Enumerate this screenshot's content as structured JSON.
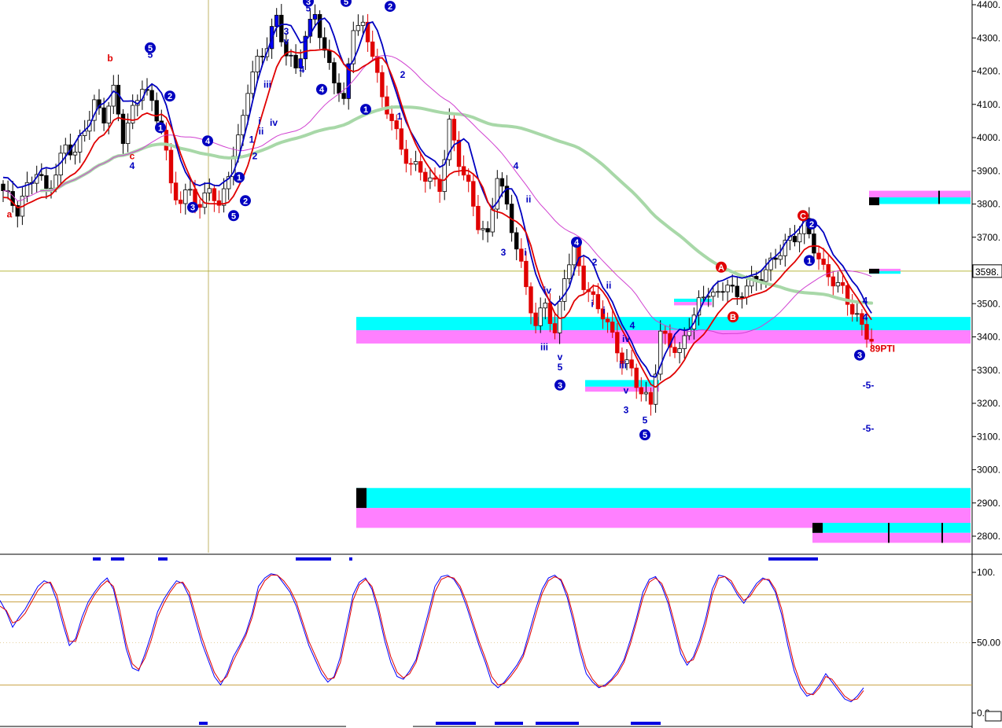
{
  "chart_data": [
    {
      "type": "candlestick",
      "y_ticks": [
        "4400.",
        "4300.",
        "4200.",
        "4100.",
        "4000.",
        "3900.",
        "3800.",
        "3700.",
        "3600.",
        "3500.",
        "3400.",
        "3300.",
        "3200.",
        "3100.",
        "3000.",
        "2900.",
        "2800."
      ],
      "ylim": [
        2750,
        4420
      ],
      "last_value_label": "3598.",
      "last_value": 3598,
      "price_path": [
        [
          0,
          3860
        ],
        [
          2,
          3820
        ],
        [
          4,
          3780
        ],
        [
          6,
          3850
        ],
        [
          8,
          3900
        ],
        [
          10,
          3840
        ],
        [
          12,
          3890
        ],
        [
          14,
          3980
        ],
        [
          16,
          3950
        ],
        [
          18,
          4030
        ],
        [
          20,
          4100
        ],
        [
          22,
          4060
        ],
        [
          24,
          4140
        ],
        [
          26,
          4000
        ],
        [
          28,
          4080
        ],
        [
          30,
          4160
        ],
        [
          32,
          4100
        ],
        [
          34,
          4030
        ],
        [
          36,
          3860
        ],
        [
          38,
          3800
        ],
        [
          40,
          3850
        ],
        [
          42,
          3780
        ],
        [
          44,
          3860
        ],
        [
          46,
          3780
        ],
        [
          48,
          3900
        ],
        [
          50,
          3990
        ],
        [
          52,
          4150
        ],
        [
          54,
          4230
        ],
        [
          56,
          4280
        ],
        [
          58,
          4360
        ],
        [
          60,
          4250
        ],
        [
          62,
          4210
        ],
        [
          64,
          4300
        ],
        [
          66,
          4380
        ],
        [
          68,
          4250
        ],
        [
          70,
          4180
        ],
        [
          72,
          4100
        ],
        [
          74,
          4340
        ],
        [
          76,
          4330
        ],
        [
          78,
          4260
        ],
        [
          80,
          4110
        ],
        [
          82,
          4060
        ],
        [
          84,
          3960
        ],
        [
          86,
          3920
        ],
        [
          88,
          3900
        ],
        [
          90,
          3870
        ],
        [
          92,
          3850
        ],
        [
          94,
          4040
        ],
        [
          96,
          3930
        ],
        [
          98,
          3850
        ],
        [
          100,
          3740
        ],
        [
          102,
          3700
        ],
        [
          104,
          3890
        ],
        [
          106,
          3790
        ],
        [
          108,
          3670
        ],
        [
          110,
          3550
        ],
        [
          112,
          3430
        ],
        [
          114,
          3510
        ],
        [
          116,
          3400
        ],
        [
          118,
          3590
        ],
        [
          120,
          3660
        ],
        [
          122,
          3560
        ],
        [
          124,
          3510
        ],
        [
          126,
          3470
        ],
        [
          128,
          3400
        ],
        [
          130,
          3330
        ],
        [
          132,
          3300
        ],
        [
          134,
          3230
        ],
        [
          136,
          3200
        ],
        [
          138,
          3410
        ],
        [
          140,
          3380
        ],
        [
          142,
          3350
        ],
        [
          144,
          3440
        ],
        [
          146,
          3500
        ],
        [
          148,
          3540
        ],
        [
          150,
          3520
        ],
        [
          152,
          3570
        ],
        [
          154,
          3510
        ],
        [
          156,
          3560
        ],
        [
          158,
          3570
        ],
        [
          160,
          3600
        ],
        [
          162,
          3640
        ],
        [
          164,
          3680
        ],
        [
          166,
          3700
        ],
        [
          168,
          3740
        ],
        [
          170,
          3670
        ],
        [
          172,
          3600
        ],
        [
          174,
          3570
        ],
        [
          176,
          3540
        ],
        [
          178,
          3480
        ],
        [
          180,
          3430
        ],
        [
          182,
          3390
        ]
      ],
      "hbars": [
        {
          "x0": 453,
          "x1": 1234,
          "top_color": "#00ffff",
          "bottom_color": "#ff80ff",
          "y_top": 3460,
          "y_mid": 3420,
          "y_bot": 3380
        },
        {
          "x0": 744,
          "x1": 838,
          "top_color": "#00ffff",
          "bottom_color": "#ff80ff",
          "y_top": 3270,
          "y_mid": 3250,
          "y_bot": 3235
        },
        {
          "x0": 857,
          "x1": 905,
          "top_color": "#00ffff",
          "bottom_color": "#ff80ff",
          "y_top": 3515,
          "y_mid": 3505,
          "y_bot": 3495
        },
        {
          "x0": 453,
          "x1": 1234,
          "top_color": "#00ffff",
          "bottom_color": "#ff80ff",
          "y_top": 2945,
          "y_mid": 2885,
          "y_bot": 2825
        },
        {
          "x0": 1105,
          "x1": 1234,
          "top_color": "#ff80ff",
          "bottom_color": "#00ffff",
          "y_top": 3840,
          "y_mid": 3820,
          "y_bot": 3800
        },
        {
          "x0": 1105,
          "x1": 1145,
          "top_color": "#ff80ff",
          "bottom_color": "#00ffff",
          "y_top": 3605,
          "y_mid": 3598,
          "y_bot": 3590
        },
        {
          "x0": 1033,
          "x1": 1234,
          "top_color": "#00ffff",
          "bottom_color": "#ff80ff",
          "y_top": 2840,
          "y_mid": 2810,
          "y_bot": 2780
        }
      ],
      "wave_labels": [
        {
          "t": "a",
          "c": "#e00000",
          "x": 12,
          "y": 3760
        },
        {
          "t": "b",
          "c": "#e00000",
          "x": 140,
          "y": 4230
        },
        {
          "t": "c",
          "c": "#e00000",
          "x": 168,
          "y": 3935
        },
        {
          "t": "4",
          "c": "#0000c0",
          "x": 168,
          "y": 3905
        },
        {
          "t": "5",
          "c": "#0000c0",
          "x": 191,
          "y": 4240
        },
        {
          "t": "1",
          "c": "#0000c0",
          "x": 320,
          "y": 3985
        },
        {
          "t": "i",
          "c": "#0000c0",
          "x": 330,
          "y": 4040
        },
        {
          "t": "ii",
          "c": "#0000c0",
          "x": 332,
          "y": 4010
        },
        {
          "t": "2",
          "c": "#0000c0",
          "x": 324,
          "y": 3935
        },
        {
          "t": "iii",
          "c": "#0000c0",
          "x": 340,
          "y": 4150
        },
        {
          "t": "iv",
          "c": "#0000c0",
          "x": 348,
          "y": 4035
        },
        {
          "t": "3",
          "c": "#0000c0",
          "x": 364,
          "y": 4310
        },
        {
          "t": "v",
          "c": "#0000c0",
          "x": 364,
          "y": 4280
        },
        {
          "t": "4",
          "c": "#0000c0",
          "x": 384,
          "y": 4195
        },
        {
          "t": "5",
          "c": "#0000c0",
          "x": 392,
          "y": 4380
        },
        {
          "t": "2",
          "c": "#0000c0",
          "x": 512,
          "y": 4180
        },
        {
          "t": "1",
          "c": "#0000c0",
          "x": 508,
          "y": 4055
        },
        {
          "t": "4",
          "c": "#0000c0",
          "x": 656,
          "y": 3905
        },
        {
          "t": "ii",
          "c": "#0000c0",
          "x": 672,
          "y": 3805
        },
        {
          "t": "3",
          "c": "#0000c0",
          "x": 640,
          "y": 3645
        },
        {
          "t": "i",
          "c": "#0000c0",
          "x": 668,
          "y": 3645
        },
        {
          "t": "iv",
          "c": "#0000c0",
          "x": 696,
          "y": 3530
        },
        {
          "t": "iii",
          "c": "#0000c0",
          "x": 692,
          "y": 3360
        },
        {
          "t": "v",
          "c": "#0000c0",
          "x": 712,
          "y": 3330
        },
        {
          "t": "5",
          "c": "#0000c0",
          "x": 712,
          "y": 3300
        },
        {
          "t": "2",
          "c": "#0000c0",
          "x": 756,
          "y": 3615
        },
        {
          "t": "ii",
          "c": "#0000c0",
          "x": 774,
          "y": 3545
        },
        {
          "t": "i",
          "c": "#0000c0",
          "x": 753,
          "y": 3490
        },
        {
          "t": "i",
          "c": "#0000c0",
          "x": 768,
          "y": 3470
        },
        {
          "t": "4",
          "c": "#0000c0",
          "x": 804,
          "y": 3425
        },
        {
          "t": "iv",
          "c": "#0000c0",
          "x": 796,
          "y": 3385
        },
        {
          "t": "iii",
          "c": "#0000c0",
          "x": 792,
          "y": 3305
        },
        {
          "t": "v",
          "c": "#0000c0",
          "x": 796,
          "y": 3230
        },
        {
          "t": "3",
          "c": "#0000c0",
          "x": 796,
          "y": 3170
        },
        {
          "t": "5",
          "c": "#0000c0",
          "x": 820,
          "y": 3140
        },
        {
          "t": "4",
          "c": "#0000c0",
          "x": 1100,
          "y": 3500
        },
        {
          "t": "4",
          "c": "#0000c0",
          "x": 1100,
          "y": 3450
        },
        {
          "t": "-5-",
          "c": "#0000c0",
          "x": 1104,
          "y": 3245
        },
        {
          "t": "-5-",
          "c": "#0000c0",
          "x": 1104,
          "y": 3115
        },
        {
          "t": "89PTI",
          "c": "#e00000",
          "x": 1122,
          "y": 3355
        }
      ],
      "wave_circles": [
        {
          "t": "5",
          "c": "#0000c0",
          "x": 191,
          "y": 4270
        },
        {
          "t": "2",
          "c": "#0000c0",
          "x": 216,
          "y": 4125
        },
        {
          "t": "1",
          "c": "#0000c0",
          "x": 204,
          "y": 4030
        },
        {
          "t": "3",
          "c": "#0000c0",
          "x": 245,
          "y": 3790
        },
        {
          "t": "4",
          "c": "#0000c0",
          "x": 264,
          "y": 3990
        },
        {
          "t": "5",
          "c": "#0000c0",
          "x": 297,
          "y": 3765
        },
        {
          "t": "1",
          "c": "#0000c0",
          "x": 304,
          "y": 3880
        },
        {
          "t": "2",
          "c": "#0000c0",
          "x": 312,
          "y": 3810
        },
        {
          "t": "4",
          "c": "#0000c0",
          "x": 409,
          "y": 4145
        },
        {
          "t": "3",
          "c": "#0000c0",
          "x": 392,
          "y": 4410
        },
        {
          "t": "5",
          "c": "#0000c0",
          "x": 440,
          "y": 4410
        },
        {
          "t": "1",
          "c": "#0000c0",
          "x": 465,
          "y": 4085
        },
        {
          "t": "2",
          "c": "#0000c0",
          "x": 496,
          "y": 4395
        },
        {
          "t": "4",
          "c": "#0000c0",
          "x": 733,
          "y": 3685
        },
        {
          "t": "3",
          "c": "#0000c0",
          "x": 712,
          "y": 3255
        },
        {
          "t": "5",
          "c": "#0000c0",
          "x": 820,
          "y": 3105
        },
        {
          "t": "A",
          "c": "#e00000",
          "x": 917,
          "y": 3610
        },
        {
          "t": "B",
          "c": "#e00000",
          "x": 932,
          "y": 3460
        },
        {
          "t": "C",
          "c": "#e00000",
          "x": 1021,
          "y": 3765
        },
        {
          "t": "2",
          "c": "#0000c0",
          "x": 1032,
          "y": 3740
        },
        {
          "t": "1",
          "c": "#0000c0",
          "x": 1029,
          "y": 3630
        },
        {
          "t": "3",
          "c": "#0000c0",
          "x": 1093,
          "y": 3345
        }
      ]
    },
    {
      "type": "line",
      "y_ticks": [
        "100.",
        "50.00",
        "0.0"
      ],
      "ylim": [
        0,
        100
      ],
      "ref_lines": [
        84,
        79,
        20
      ],
      "series": [
        {
          "color": "#0000ff",
          "values": [
            80,
            72,
            61,
            68,
            74,
            82,
            90,
            94,
            92,
            80,
            63,
            48,
            53,
            68,
            79,
            86,
            92,
            96,
            88,
            68,
            46,
            32,
            30,
            42,
            56,
            72,
            81,
            88,
            94,
            92,
            83,
            66,
            50,
            38,
            26,
            20,
            28,
            40,
            48,
            57,
            71,
            90,
            96,
            99,
            98,
            92,
            86,
            76,
            62,
            48,
            38,
            28,
            22,
            26,
            40,
            62,
            84,
            93,
            96,
            88,
            72,
            52,
            36,
            26,
            24,
            30,
            38,
            55,
            72,
            90,
            97,
            98,
            95,
            88,
            76,
            62,
            48,
            36,
            22,
            18,
            22,
            28,
            34,
            42,
            58,
            74,
            88,
            96,
            98,
            94,
            82,
            64,
            44,
            28,
            22,
            18,
            20,
            24,
            30,
            38,
            52,
            68,
            86,
            95,
            97,
            90,
            78,
            60,
            42,
            34,
            40,
            52,
            68,
            88,
            98,
            97,
            92,
            84,
            78,
            85,
            92,
            96,
            94,
            86,
            70,
            48,
            30,
            18,
            12,
            14,
            20,
            28,
            22,
            16,
            10,
            8,
            12,
            18
          ]
        },
        {
          "color": "#e00000",
          "values": [
            76,
            73,
            64,
            66,
            71,
            79,
            87,
            92,
            93,
            84,
            67,
            51,
            51,
            64,
            76,
            84,
            90,
            94,
            90,
            73,
            50,
            35,
            31,
            39,
            52,
            68,
            78,
            86,
            92,
            93,
            86,
            70,
            54,
            41,
            29,
            22,
            26,
            37,
            46,
            55,
            68,
            86,
            94,
            98,
            98,
            94,
            88,
            79,
            65,
            51,
            41,
            31,
            24,
            25,
            36,
            57,
            80,
            91,
            95,
            90,
            76,
            56,
            40,
            29,
            25,
            28,
            36,
            51,
            68,
            86,
            95,
            97,
            96,
            90,
            79,
            65,
            51,
            39,
            26,
            20,
            21,
            26,
            32,
            40,
            54,
            70,
            85,
            94,
            97,
            95,
            85,
            68,
            48,
            32,
            24,
            19,
            19,
            23,
            28,
            36,
            49,
            65,
            82,
            93,
            96,
            92,
            81,
            64,
            46,
            36,
            38,
            49,
            64,
            84,
            96,
            97,
            94,
            86,
            80,
            83,
            90,
            95,
            95,
            88,
            74,
            53,
            34,
            21,
            14,
            13,
            18,
            26,
            24,
            18,
            12,
            9,
            10,
            16
          ]
        }
      ],
      "legend_marks_top": [
        [
          118,
          128
        ],
        [
          141,
          158
        ],
        [
          201,
          213
        ],
        [
          376,
          421
        ],
        [
          444,
          448
        ],
        [
          977,
          1040
        ]
      ],
      "legend_marks_bottom": [
        [
          253,
          264
        ],
        [
          554,
          605
        ],
        [
          629,
          665
        ],
        [
          681,
          736
        ],
        [
          802,
          840
        ]
      ]
    }
  ]
}
